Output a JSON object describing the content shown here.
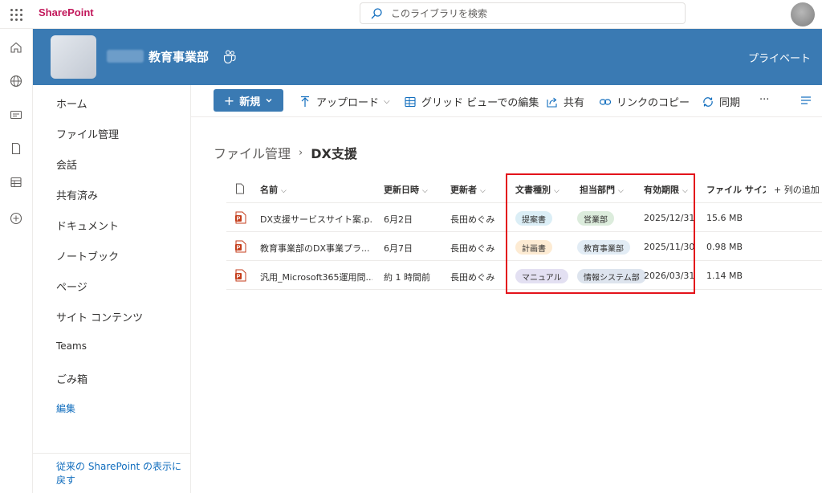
{
  "topbar": {
    "brand": "SharePoint",
    "search_placeholder": "このライブラリを検索"
  },
  "site": {
    "title": "教育事業部",
    "privacy": "プライベート"
  },
  "nav": {
    "items": [
      "ホーム",
      "ファイル管理",
      "会話",
      "共有済み",
      "ドキュメント",
      "ノートブック",
      "ページ",
      "サイト コンテンツ",
      "Teams",
      "ごみ箱",
      "編集"
    ],
    "footer": "従来の SharePoint の表示に戻す"
  },
  "commands": {
    "new": "新規",
    "upload": "アップロード",
    "grid_edit": "グリッド ビューでの編集",
    "share": "共有",
    "copy_link": "リンクのコピー",
    "sync": "同期",
    "more": "···"
  },
  "breadcrumb": {
    "parent": "ファイル管理",
    "current": "DX支援"
  },
  "table": {
    "columns": {
      "name": "名前",
      "modified": "更新日時",
      "modified_by": "更新者",
      "doc_type": "文書種別",
      "department": "担当部門",
      "expiry": "有効期限",
      "file_size": "ファイル サイズ",
      "add_column": "+ 列の追加"
    },
    "rows": [
      {
        "name": "DX支援サービスサイト案.p...",
        "modified": "6月2日",
        "modified_by": "長田めぐみ",
        "doc_type": "提案書",
        "department": "営業部",
        "expiry": "2025/12/31",
        "file_size": "15.6 MB"
      },
      {
        "name": "教育事業部のDX事業プラ...",
        "modified": "6月7日",
        "modified_by": "長田めぐみ",
        "doc_type": "計画書",
        "department": "教育事業部",
        "expiry": "2025/11/30",
        "file_size": "0.98 MB"
      },
      {
        "name": "汎用_Microsoft365運用問...",
        "modified": "約 1 時間前",
        "modified_by": "長田めぐみ",
        "doc_type": "マニュアル",
        "department": "情報システム部",
        "expiry": "2026/03/31",
        "file_size": "1.14 MB"
      }
    ]
  },
  "colors": {
    "brand": "#c2185b",
    "header_bg": "#3a7ab3",
    "link": "#0f6cbd",
    "highlight_box": "#e3131b",
    "tag_proposal": "#dbeef6",
    "tag_plan": "#fdebd3",
    "tag_manual": "#e3e0f2",
    "tag_dept": "#dcecdc"
  }
}
